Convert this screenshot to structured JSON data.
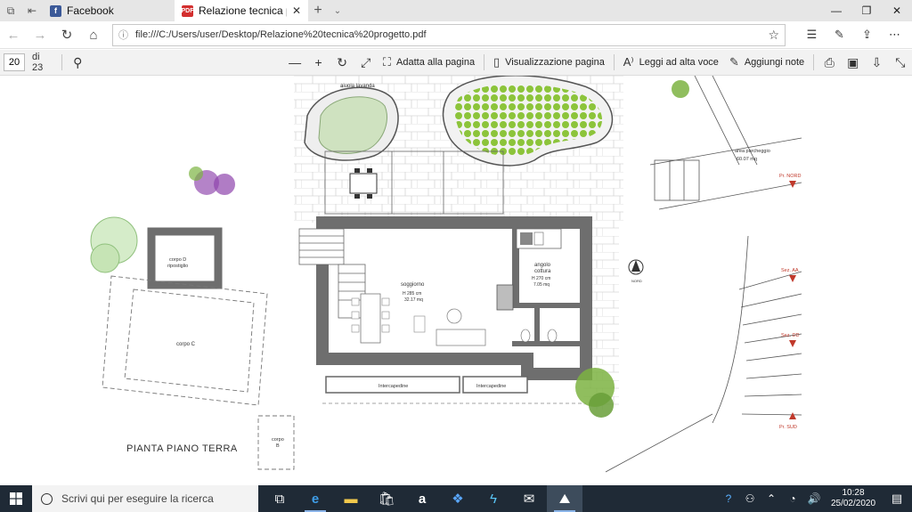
{
  "browser": {
    "tabs": [
      {
        "title": "Facebook",
        "favicon": "facebook-icon",
        "active": false
      },
      {
        "title": "Relazione tecnica proge",
        "favicon": "pdf-icon",
        "active": true
      }
    ],
    "address": "file:///C:/Users/user/Desktop/Relazione%20tecnica%20progetto.pdf"
  },
  "pdf_toolbar": {
    "current_page": "20",
    "total_pages": "di 23",
    "fit_page_label": "Adatta alla pagina",
    "page_view_label": "Visualizzazione pagina",
    "read_aloud_label": "Leggi ad alta voce",
    "add_notes_label": "Aggiungi note"
  },
  "drawing": {
    "title": "PIANTA PIANO TERRA",
    "labels": {
      "aiuola": "aiuola lavanda",
      "soggiorno": "soggiorno",
      "soggiorno_h": "H 285 cm",
      "soggiorno_area": "32.17 mq",
      "angolo": "angolo",
      "cottura": "cottura",
      "cottura_h": "H 270 cm",
      "cottura_area": "7.05 mq",
      "corpo_d": "corpo D",
      "ripostiglio": "ripostiglio",
      "corpo_c": "corpo C",
      "corpo_b": "corpo",
      "corpo_b2": "B",
      "intercapedine1": "Intercapedine",
      "intercapedine2": "Intercapedine",
      "parcheggio": "area parcheggio",
      "parcheggio_area": "60.07 mq",
      "sez_aa": "Sez. AA",
      "sez_dd": "Sez. DD",
      "prosp_nord": "Pr. NORD",
      "prosp_sud": "Pr. SUD",
      "nord": "NORD"
    }
  },
  "taskbar": {
    "search_placeholder": "Scrivi qui per eseguire la ricerca",
    "time": "10:28",
    "date": "25/02/2020"
  }
}
